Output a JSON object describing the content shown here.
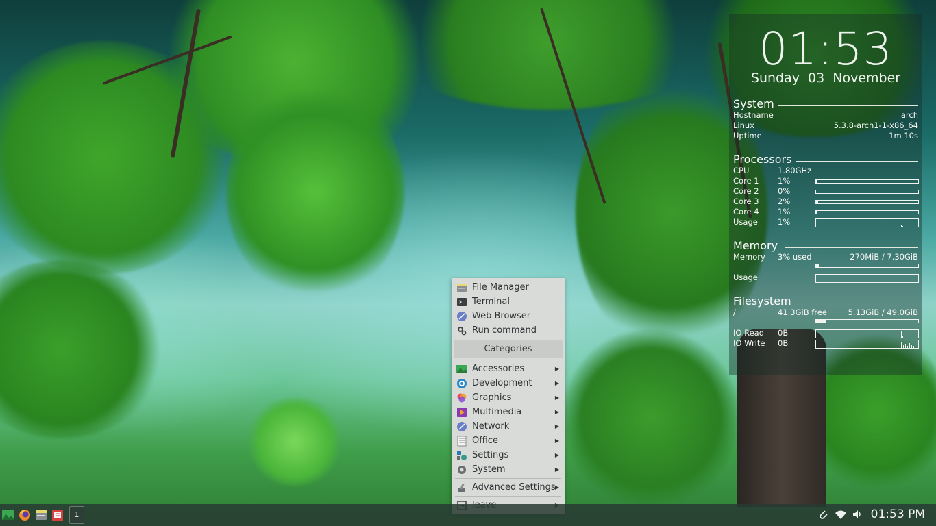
{
  "clock": {
    "time": "01:53",
    "date": "Sunday  03 November"
  },
  "system": {
    "title": "System",
    "rows": [
      {
        "label": "Hostname",
        "value": "arch"
      },
      {
        "label": "Linux",
        "value": "5.3.8-arch1-1-x86_64"
      },
      {
        "label": "Uptime",
        "value": "1m 10s"
      }
    ]
  },
  "processors": {
    "title": "Processors",
    "cpu_label": "CPU",
    "cpu_value": "1.80GHz",
    "cores": [
      {
        "label": "Core 1",
        "value": "1%",
        "usage": 1
      },
      {
        "label": "Core 2",
        "value": "0%",
        "usage": 0
      },
      {
        "label": "Core 3",
        "value": "2%",
        "usage": 2
      },
      {
        "label": "Core 4",
        "value": "1%",
        "usage": 1
      }
    ],
    "usage_label": "Usage",
    "usage_value": "1%"
  },
  "memory": {
    "title": "Memory",
    "label": "Memory",
    "used": "3% used",
    "amount": "270MiB / 7.30GiB",
    "usage": 3,
    "usage_label": "Usage"
  },
  "filesystem": {
    "title": "Filesystem",
    "mount": "/",
    "free": "41.3GiB free",
    "amount": "5.13GiB / 49.0GiB",
    "usage": 10,
    "io_read_label": "IO Read",
    "io_read_value": "0B",
    "io_write_label": "IO Write",
    "io_write_value": "0B"
  },
  "menu": {
    "top_items": [
      {
        "label": "File Manager",
        "icon": "file-manager-icon"
      },
      {
        "label": "Terminal",
        "icon": "terminal-icon"
      },
      {
        "label": "Web Browser",
        "icon": "web-browser-icon"
      },
      {
        "label": "Run command",
        "icon": "run-command-icon"
      }
    ],
    "categories_header": "Categories",
    "categories": [
      {
        "label": "Accessories",
        "icon": "accessories-icon"
      },
      {
        "label": "Development",
        "icon": "development-icon"
      },
      {
        "label": "Graphics",
        "icon": "graphics-icon"
      },
      {
        "label": "Multimedia",
        "icon": "multimedia-icon"
      },
      {
        "label": "Network",
        "icon": "network-icon"
      },
      {
        "label": "Office",
        "icon": "office-icon"
      },
      {
        "label": "Settings",
        "icon": "settings-icon"
      },
      {
        "label": "System",
        "icon": "system-icon"
      }
    ],
    "advanced": {
      "label": "Advanced Settings",
      "icon": "advanced-settings-icon"
    },
    "leave": {
      "label": "leave",
      "icon": "leave-icon"
    }
  },
  "taskbar": {
    "workspace": "1",
    "clock": "01:53 PM",
    "launchers": [
      "menu-icon",
      "firefox-icon",
      "file-manager-icon",
      "text-editor-icon"
    ],
    "tray": [
      "clipboard-icon",
      "wifi-icon",
      "volume-icon"
    ]
  }
}
